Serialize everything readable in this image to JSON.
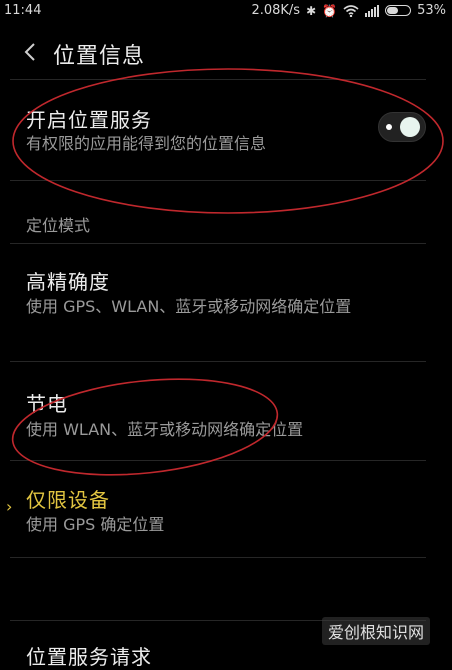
{
  "status_bar": {
    "time": "11:44",
    "network_speed": "2.08K/s",
    "battery_percent": "53%",
    "battery_level": 0.53,
    "icons": [
      "bluetooth-icon",
      "alarm-icon",
      "wifi-icon",
      "signal-icon",
      "battery-icon"
    ]
  },
  "header": {
    "title": "位置信息",
    "back_icon": "chevron-left-icon"
  },
  "location_service": {
    "title": "开启位置服务",
    "description": "有权限的应用能得到您的位置信息",
    "enabled": true
  },
  "mode_section": {
    "label": "定位模式",
    "options": [
      {
        "title": "高精确度",
        "description": "使用 GPS、WLAN、蓝牙或移动网络确定位置",
        "selected": false
      },
      {
        "title": "节电",
        "description": "使用 WLAN、蓝牙或移动网络确定位置",
        "selected": false
      },
      {
        "title": "仅限设备",
        "description": "使用 GPS 确定位置",
        "selected": true
      }
    ]
  },
  "next_item": {
    "title": "位置服务请求"
  },
  "watermark": "爱创根知识网",
  "colors": {
    "background": "#000000",
    "selected": "#e2c541",
    "annotation": "#c0282d"
  }
}
